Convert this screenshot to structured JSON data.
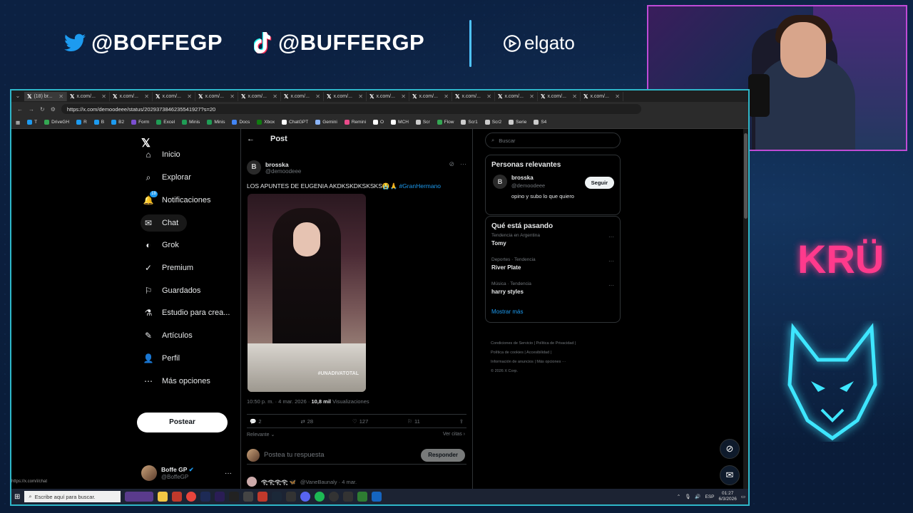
{
  "overlay": {
    "twitter_handle": "@BOFFEGP",
    "tiktok_handle": "@BUFFERGP",
    "sponsor": "elgato",
    "brand": "KRÜ"
  },
  "browser": {
    "tabs": [
      {
        "label": "(18) br..."
      },
      {
        "label": "x.com/..."
      },
      {
        "label": "x.com/..."
      },
      {
        "label": "x.com/..."
      },
      {
        "label": "x.com/..."
      },
      {
        "label": "x.com/..."
      },
      {
        "label": "x.com/..."
      },
      {
        "label": "x.com/..."
      },
      {
        "label": "x.com/..."
      },
      {
        "label": "x.com/..."
      },
      {
        "label": "x.com/..."
      },
      {
        "label": "x.com/..."
      },
      {
        "label": "x.com/..."
      },
      {
        "label": "x.com/..."
      }
    ],
    "url": "https://x.com/demoodeee/status/2029373846235541927?s=20",
    "bookmarks": [
      {
        "label": "T",
        "color": "#1d9bf0"
      },
      {
        "label": "DriveGH",
        "color": "#34a853"
      },
      {
        "label": "R",
        "color": "#1d9bf0"
      },
      {
        "label": "B",
        "color": "#1d9bf0"
      },
      {
        "label": "B2",
        "color": "#1d9bf0"
      },
      {
        "label": "Form",
        "color": "#7b4fd1"
      },
      {
        "label": "Excel",
        "color": "#1f9d55"
      },
      {
        "label": "Minis",
        "color": "#1f9d55"
      },
      {
        "label": "Minis",
        "color": "#1f9d55"
      },
      {
        "label": "Docs",
        "color": "#4285f4"
      },
      {
        "label": "Xbox",
        "color": "#107c10"
      },
      {
        "label": "ChatGPT",
        "color": "#ffffff"
      },
      {
        "label": "Gemini",
        "color": "#8ab4f8"
      },
      {
        "label": "Remini",
        "color": "#e94b8a"
      },
      {
        "label": "O",
        "color": "#ffffff"
      },
      {
        "label": "MCH",
        "color": "#ffffff"
      },
      {
        "label": "Scr",
        "color": "#cccccc"
      },
      {
        "label": "Flow",
        "color": "#34a853"
      },
      {
        "label": "Scr1",
        "color": "#cccccc"
      },
      {
        "label": "Scr2",
        "color": "#cccccc"
      },
      {
        "label": "Serie",
        "color": "#cccccc"
      },
      {
        "label": "S4",
        "color": "#cccccc"
      }
    ],
    "status_link": "https://x.com/i/chat"
  },
  "nav": {
    "items": [
      {
        "label": "Inicio",
        "icon": "home-icon"
      },
      {
        "label": "Explorar",
        "icon": "search-icon"
      },
      {
        "label": "Notificaciones",
        "icon": "bell-icon",
        "badge": "18"
      },
      {
        "label": "Chat",
        "icon": "mail-icon"
      },
      {
        "label": "Grok",
        "icon": "grok-icon"
      },
      {
        "label": "Premium",
        "icon": "premium-icon"
      },
      {
        "label": "Guardados",
        "icon": "bookmark-icon"
      },
      {
        "label": "Estudio para crea...",
        "icon": "studio-icon"
      },
      {
        "label": "Artículos",
        "icon": "articles-icon"
      },
      {
        "label": "Perfil",
        "icon": "profile-icon"
      },
      {
        "label": "Más opciones",
        "icon": "more-icon"
      }
    ],
    "post_button": "Postear",
    "account": {
      "name": "Boffe GP",
      "handle": "@BoffeGP"
    }
  },
  "post": {
    "header": "Post",
    "author_initial": "B",
    "author_name": "brosska",
    "author_handle": "@demoodeee",
    "text": "LOS APUNTES DE EUGENIA AKDKSKDKSKSKS😭🙏",
    "hashtag": "#GranHermano",
    "image_watermark": "#UNADIVATOTAL",
    "time": "10:50 p. m. · 4 mar. 2026 · ",
    "views_count": "10,8 mil",
    "views_label": " Visualizaciones",
    "replies": "2",
    "reposts": "28",
    "likes": "127",
    "bookmarks": "11",
    "sort_label": "Relevante",
    "quotes_label": "Ver citas",
    "reply_placeholder": "Postea tu respuesta",
    "reply_button": "Responder",
    "next_post_name": "𓂀𓂀𓂀𓂀 🦋",
    "next_post_handle": "@VaneBaunaly · 4 mar."
  },
  "sidebar": {
    "search_placeholder": "Buscar",
    "relevant_title": "Personas relevantes",
    "relevant": {
      "initial": "B",
      "name": "brosska",
      "handle": "@demoodeee",
      "bio": "opino y subo lo que quiero",
      "follow": "Seguir"
    },
    "trends_title": "Qué está pasando",
    "trends": [
      {
        "category": "Tendencia en Argentina",
        "name": "Tomy"
      },
      {
        "category": "Deportes · Tendencia",
        "name": "River Plate"
      },
      {
        "category": "Música · Tendencia",
        "name": "harry styles"
      }
    ],
    "show_more": "Mostrar más",
    "footer": [
      "Condiciones de Servicio  |  Política de Privacidad  |",
      "Política de cookies  |  Accesibilidad  |",
      "Información de anuncios  |  Más opciones ···",
      "© 2026 X Corp."
    ]
  },
  "taskbar": {
    "search_placeholder": "Escribe aquí para buscar.",
    "language": "ESP",
    "time": "01:27",
    "date": "6/3/2026"
  }
}
